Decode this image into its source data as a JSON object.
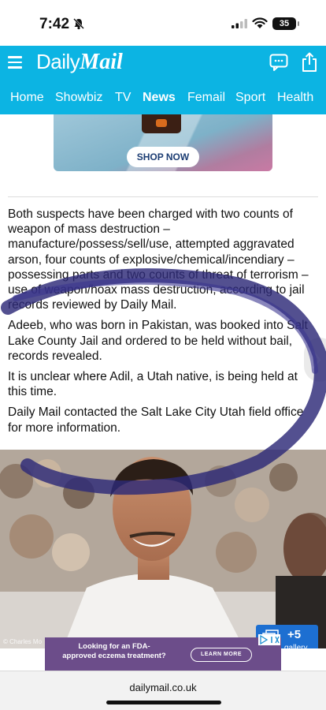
{
  "status_bar": {
    "time": "7:42",
    "battery": "35"
  },
  "header": {
    "logo_part1": "Daily",
    "logo_part2": "Mail",
    "nav": [
      "Home",
      "Showbiz",
      "TV",
      "News",
      "Femail",
      "Sport",
      "Health"
    ],
    "active_nav": "News"
  },
  "ad_top": {
    "cta": "SHOP NOW"
  },
  "article": {
    "paragraphs": [
      "Both suspects have been charged with two counts of weapon of mass destruction – manufacture/possess/sell/use, attempted aggravated arson, four counts of explosive/chemical/incendiary – possessing parts and two counts of threat of terrorism – use of weapon/hoax mass destruction, according to jail records reviewed by Daily Mail.",
      "Adeeb, who was born in Pakistan, was booked into Salt Lake County Jail and ordered to be held without bail, records revealed.",
      "It is unclear where Adil, a Utah native, is being held at this time.",
      "Daily Mail contacted the Salt Lake City Utah field office for more information."
    ]
  },
  "photo": {
    "credit": "© Charles Mo",
    "gallery_count": "+5",
    "gallery_label": "gallery"
  },
  "ad_bottom": {
    "text": "Looking for an FDA-approved eczema treatment?",
    "cta": "LEARN MORE"
  },
  "browser": {
    "url": "dailymail.co.uk"
  },
  "colors": {
    "brand": "#0cb4e3",
    "gallery": "#1d6fd1",
    "ad_bottom": "#6c4d8a"
  }
}
